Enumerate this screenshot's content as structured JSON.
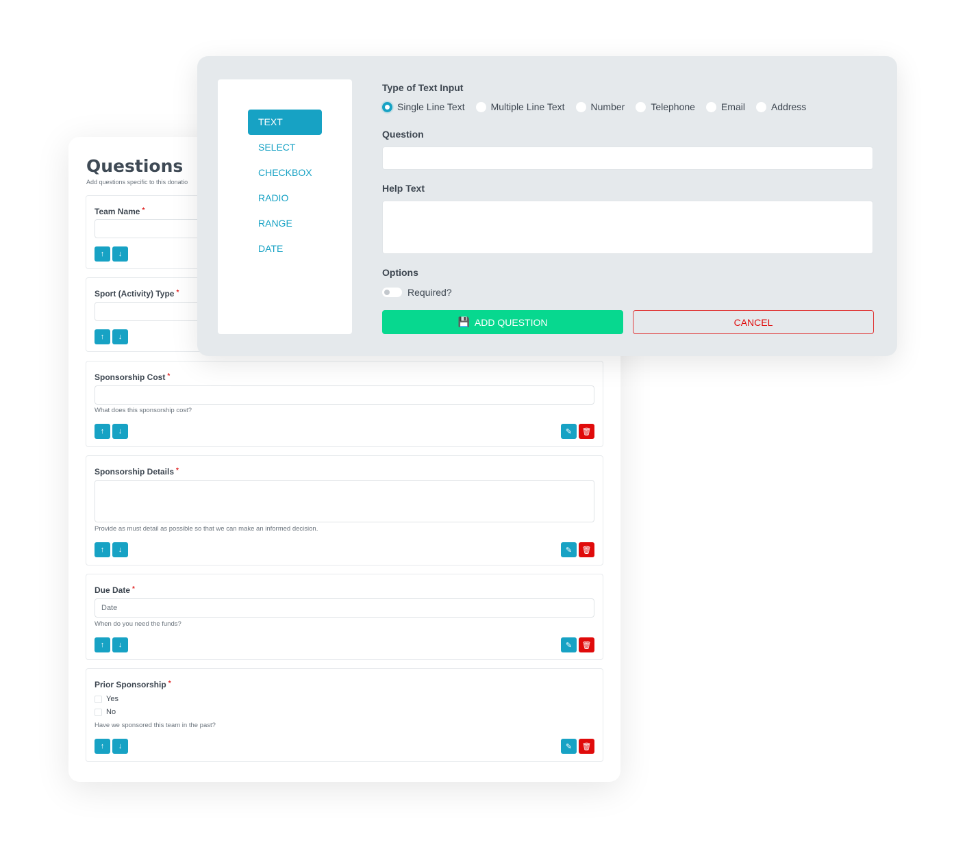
{
  "questions_panel": {
    "title": "Questions",
    "subtitle": "Add questions specific to this donatio",
    "required_marker": "*",
    "items": [
      {
        "label": "Team Name",
        "input": "",
        "help": ""
      },
      {
        "label": "Sport (Activity) Type",
        "input": "",
        "help": ""
      },
      {
        "label": "Sponsorship Cost",
        "input": "",
        "help": "What does this sponsorship cost?"
      },
      {
        "label": "Sponsorship Details",
        "input": "",
        "help": "Provide as must detail as possible so that we can make an informed decision."
      },
      {
        "label": "Due Date",
        "input": "Date",
        "help": "When do you need the funds?"
      },
      {
        "label": "Prior Sponsorship",
        "options": [
          "Yes",
          "No"
        ],
        "help": "Have we sponsored this team in the past?"
      }
    ]
  },
  "modal": {
    "menu": [
      "TEXT",
      "SELECT",
      "CHECKBOX",
      "RADIO",
      "RANGE",
      "DATE"
    ],
    "active_menu": "TEXT",
    "type_label": "Type of Text Input",
    "types": [
      "Single Line Text",
      "Multiple Line Text",
      "Number",
      "Telephone",
      "Email",
      "Address"
    ],
    "selected_type": "Single Line Text",
    "question_label": "Question",
    "question_value": "",
    "help_label": "Help Text",
    "help_value": "",
    "options_label": "Options",
    "required_label": "Required?",
    "required": false,
    "add_label": "ADD QUESTION",
    "cancel_label": "CANCEL"
  },
  "colors": {
    "accent": "#17a2c4",
    "success": "#07d88f",
    "danger": "#e00b0b"
  }
}
